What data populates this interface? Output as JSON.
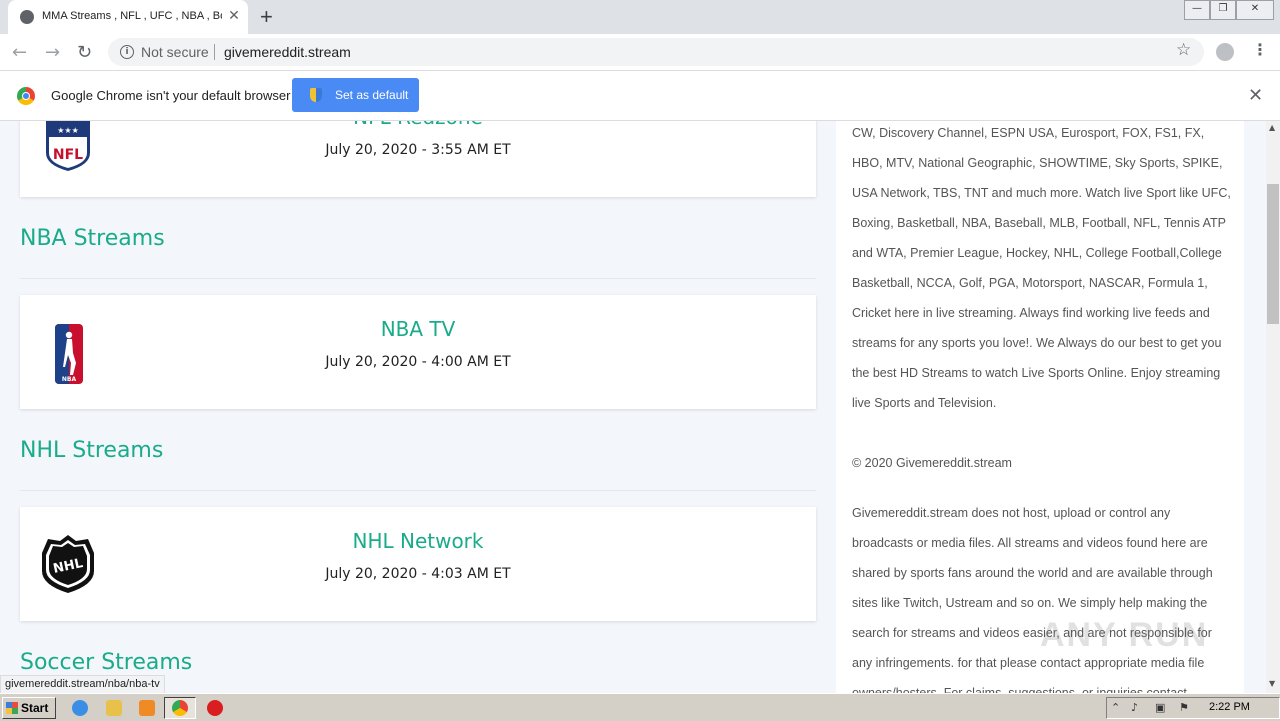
{
  "browser": {
    "tab_title": "MMA Streams , NFL , UFC , NBA , Bo",
    "tab_close": "✕",
    "new_tab": "+",
    "not_secure": "Not secure",
    "url": "givemereddit.stream",
    "infobar_text": "Google Chrome isn't your default browser",
    "set_default_label": "Set as default",
    "infobar_close": "✕",
    "status_url": "givemereddit.stream/nba/nba-tv"
  },
  "window_controls": {
    "minimize": "—",
    "restore": "❐",
    "close": "✕"
  },
  "main": {
    "cards": [
      {
        "title": "NFL Redzone",
        "date": "July 20, 2020 - 3:55 AM ET",
        "logo": "nfl-logo"
      },
      {
        "title": "NBA TV",
        "date": "July 20, 2020 - 4:00 AM ET",
        "logo": "nba-logo"
      },
      {
        "title": "NHL Network",
        "date": "July 20, 2020 - 4:03 AM ET",
        "logo": "nhl-logo"
      }
    ],
    "sections": [
      "NBA Streams",
      "NHL Streams",
      "Soccer Streams"
    ]
  },
  "sidebar": {
    "p1": "CW, Discovery Channel, ESPN USA, Eurosport, FOX, FS1, FX, HBO, MTV, National Geographic, SHOWTIME, Sky Sports, SPIKE, USA Network, TBS, TNT and much more. Watch live Sport like UFC, Boxing, Basketball, NBA, Baseball, MLB, Football, NFL, Tennis ATP and WTA, Premier League, Hockey, NHL, College Football,College Basketball, NCCA, Golf, PGA, Motorsport, NASCAR, Formula 1, Cricket here in live streaming. Always find working live feeds and streams for any sports you love!. We Always do our best to get you the best HD Streams to watch Live Sports Online. Enjoy streaming live Sports and Television.",
    "copyright": "© 2020 Givemereddit.stream",
    "p2": "Givemereddit.stream does not host, upload or control any broadcasts or media files. All streams and videos found here are shared by sports fans around the world and are available through sites like Twitch, Ustream and so on. We simply help making the search for streams and videos easier, and are not responsible for any infringements. for that please contact appropriate media file owners/hosters. For claims, suggestions, or inquiries contact"
  },
  "taskbar": {
    "start_label": "Start",
    "clock": "2:22 PM"
  },
  "watermark": "ANY RUN",
  "colors": {
    "accent": "#1aab8a",
    "page_bg": "#f3f6fb",
    "button_blue": "#4a8af4"
  }
}
